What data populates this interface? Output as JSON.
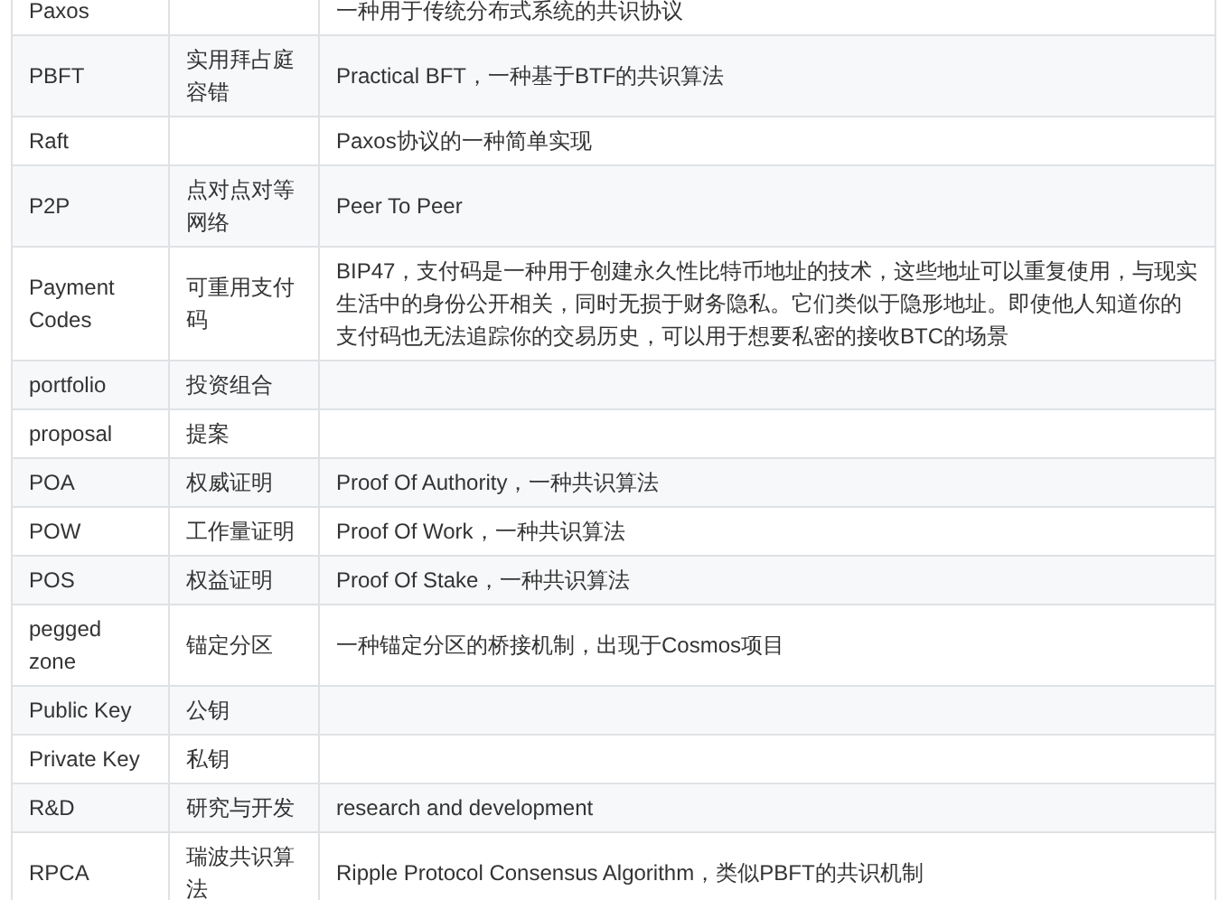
{
  "table": {
    "rows": [
      {
        "term": "Paxos",
        "chinese": "",
        "description": "一种用于传统分布式系统的共识协议"
      },
      {
        "term": "PBFT",
        "chinese": "实用拜占庭容错",
        "description": "Practical BFT，一种基于BTF的共识算法"
      },
      {
        "term": "Raft",
        "chinese": "",
        "description": "Paxos协议的一种简单实现"
      },
      {
        "term": "P2P",
        "chinese": "点对点对等网络",
        "description": "Peer To Peer"
      },
      {
        "term": "Payment Codes",
        "chinese": "可重用支付码",
        "description": "BIP47，支付码是一种用于创建永久性比特币地址的技术，这些地址可以重复使用，与现实生活中的身份公开相关，同时无损于财务隐私。它们类似于隐形地址。即使他人知道你的支付码也无法追踪你的交易历史，可以用于想要私密的接收BTC的场景"
      },
      {
        "term": "portfolio",
        "chinese": "投资组合",
        "description": ""
      },
      {
        "term": "proposal",
        "chinese": "提案",
        "description": ""
      },
      {
        "term": "POA",
        "chinese": "权威证明",
        "description": "Proof Of Authority，一种共识算法"
      },
      {
        "term": "POW",
        "chinese": "工作量证明",
        "description": "Proof Of Work，一种共识算法"
      },
      {
        "term": "POS",
        "chinese": "权益证明",
        "description": "Proof Of Stake，一种共识算法"
      },
      {
        "term": "pegged zone",
        "chinese": "锚定分区",
        "description": "一种锚定分区的桥接机制，出现于Cosmos项目"
      },
      {
        "term": "Public Key",
        "chinese": "公钥",
        "description": ""
      },
      {
        "term": "Private Key",
        "chinese": "私钥",
        "description": ""
      },
      {
        "term": "R&D",
        "chinese": "研究与开发",
        "description": "research and development"
      },
      {
        "term": "RPCA",
        "chinese": "瑞波共识算法",
        "description": "Ripple Protocol Consensus Algorithm，类似PBFT的共识机制"
      }
    ]
  }
}
